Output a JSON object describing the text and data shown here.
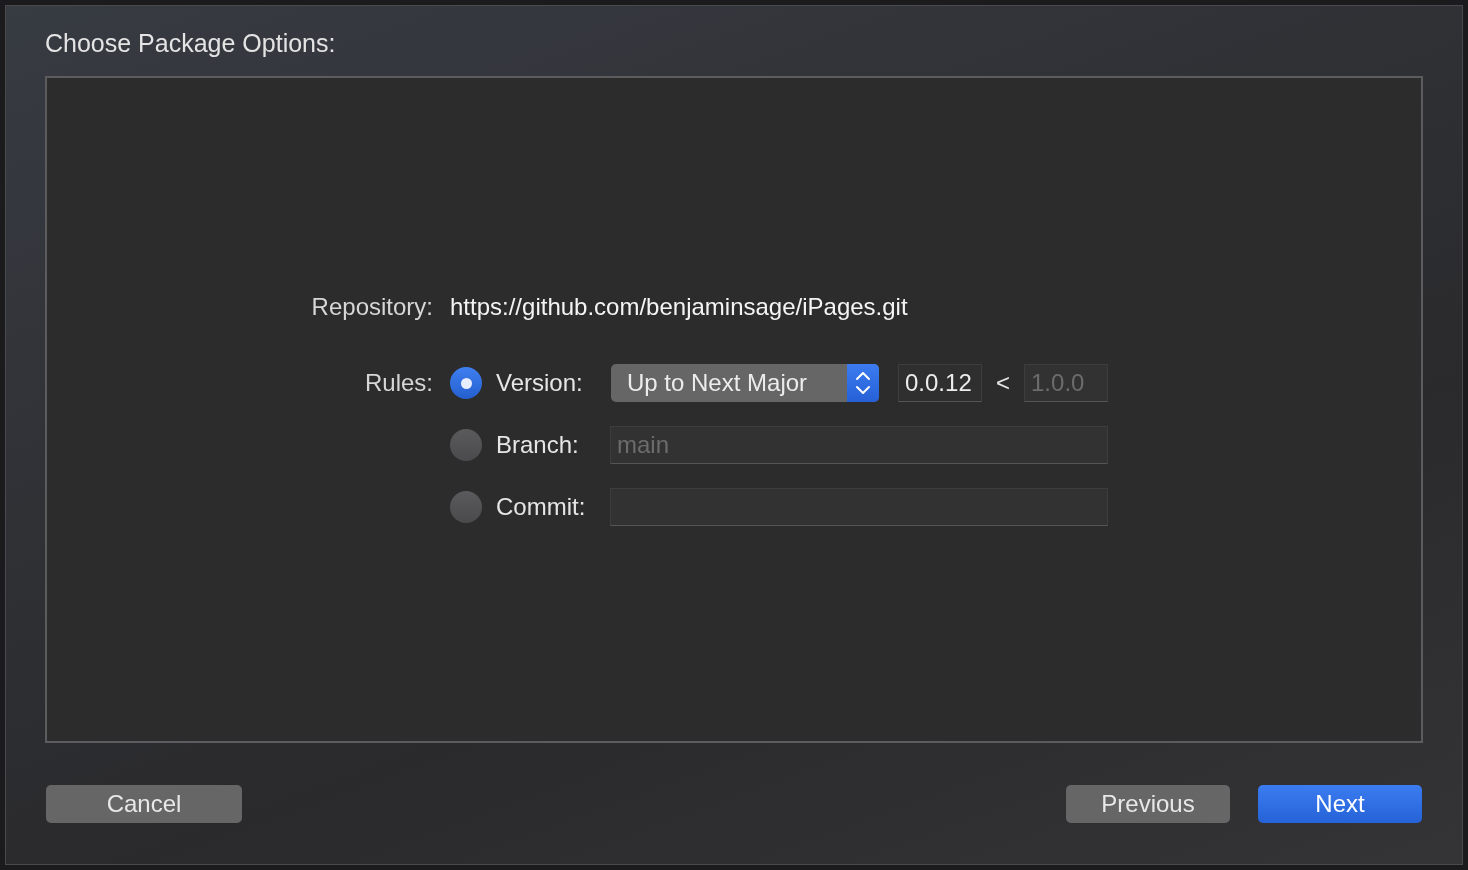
{
  "sheet": {
    "title": "Choose Package Options:"
  },
  "repository": {
    "label": "Repository:",
    "url": "https://github.com/benjaminsage/iPages.git"
  },
  "rules": {
    "label": "Rules:",
    "options": [
      {
        "kind": "version",
        "label": "Version:",
        "selected": true,
        "popup": "Up to Next Major",
        "lower": "0.0.12",
        "separator": "<",
        "upper_placeholder": "1.0.0"
      },
      {
        "kind": "branch",
        "label": "Branch:",
        "selected": false,
        "placeholder": "main"
      },
      {
        "kind": "commit",
        "label": "Commit:",
        "selected": false
      }
    ]
  },
  "buttons": [
    {
      "label": "Cancel",
      "kind": "secondary"
    },
    {
      "label": "Previous",
      "kind": "secondary"
    },
    {
      "label": "Next",
      "kind": "primary"
    }
  ]
}
